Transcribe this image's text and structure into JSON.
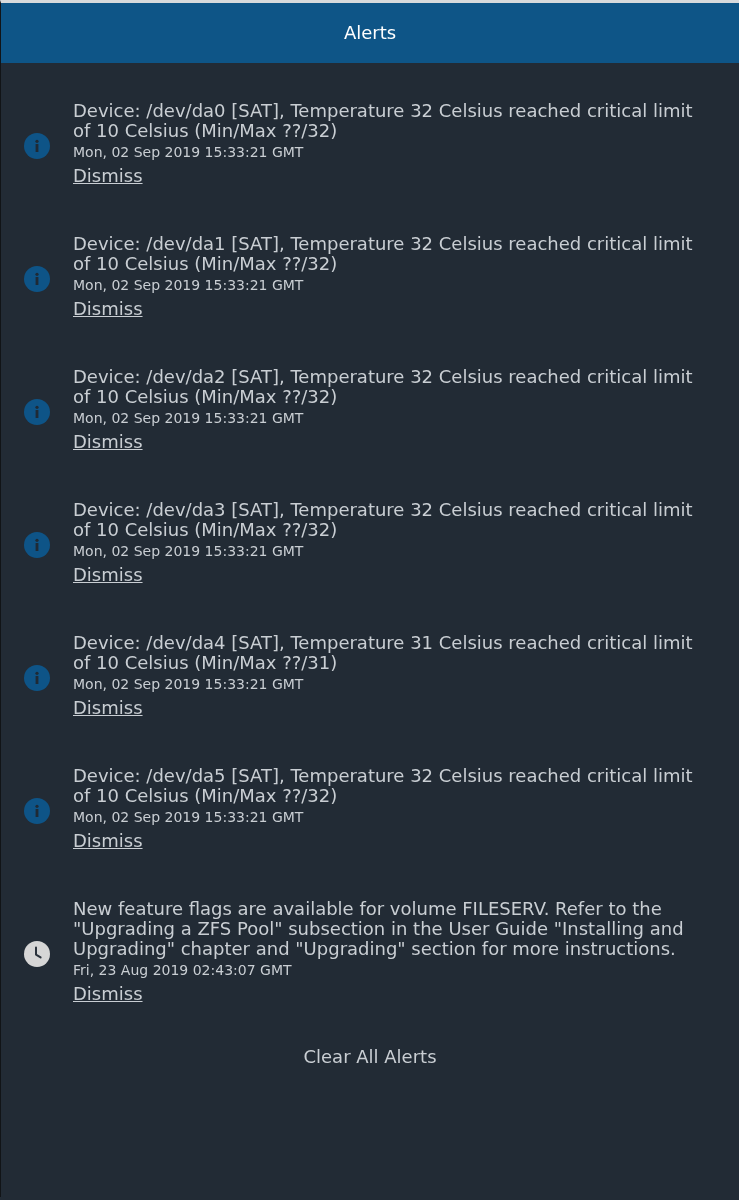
{
  "header": {
    "title": "Alerts"
  },
  "alerts": [
    {
      "kind": "info",
      "message": "Device: /dev/da0 [SAT], Temperature 32 Celsius reached critical limit of 10 Celsius (Min/Max ??/32)",
      "timestamp": "Mon, 02 Sep 2019 15:33:21 GMT",
      "action": "Dismiss"
    },
    {
      "kind": "info",
      "message": "Device: /dev/da1 [SAT], Temperature 32 Celsius reached critical limit of 10 Celsius (Min/Max ??/32)",
      "timestamp": "Mon, 02 Sep 2019 15:33:21 GMT",
      "action": "Dismiss"
    },
    {
      "kind": "info",
      "message": "Device: /dev/da2 [SAT], Temperature 32 Celsius reached critical limit of 10 Celsius (Min/Max ??/32)",
      "timestamp": "Mon, 02 Sep 2019 15:33:21 GMT",
      "action": "Dismiss"
    },
    {
      "kind": "info",
      "message": "Device: /dev/da3 [SAT], Temperature 32 Celsius reached critical limit of 10 Celsius (Min/Max ??/32)",
      "timestamp": "Mon, 02 Sep 2019 15:33:21 GMT",
      "action": "Dismiss"
    },
    {
      "kind": "info",
      "message": "Device: /dev/da4 [SAT], Temperature 31 Celsius reached critical limit of 10 Celsius (Min/Max ??/31)",
      "timestamp": "Mon, 02 Sep 2019 15:33:21 GMT",
      "action": "Dismiss"
    },
    {
      "kind": "info",
      "message": "Device: /dev/da5 [SAT], Temperature 32 Celsius reached critical limit of 10 Celsius (Min/Max ??/32)",
      "timestamp": "Mon, 02 Sep 2019 15:33:21 GMT",
      "action": "Dismiss"
    },
    {
      "kind": "clock",
      "message": "New feature flags are available for volume FILESERV. Refer to the \"Upgrading a ZFS Pool\" subsection in the User Guide \"Installing and Upgrading\" chapter and \"Upgrading\" section for more instructions.",
      "timestamp": "Fri, 23 Aug 2019 02:43:07 GMT",
      "action": "Dismiss"
    }
  ],
  "footer": {
    "clear_button": "Clear All Alerts"
  }
}
